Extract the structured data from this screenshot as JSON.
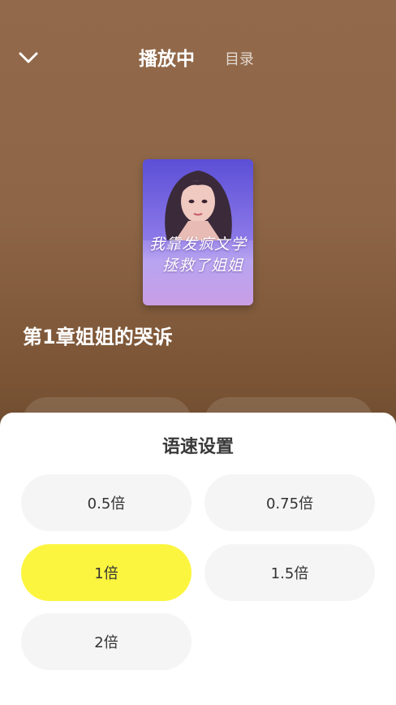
{
  "header": {
    "playing_tab": "播放中",
    "catalog_tab": "目录"
  },
  "cover": {
    "title_line1": "我靠发疯文学",
    "title_line2": "拯救了姐姐"
  },
  "chapter": {
    "title": "第1章姐姐的哭诉"
  },
  "speed_sheet": {
    "title": "语速设置",
    "selected": "1倍",
    "options": [
      {
        "label": "0.5倍"
      },
      {
        "label": "0.75倍"
      },
      {
        "label": "1倍"
      },
      {
        "label": "1.5倍"
      },
      {
        "label": "2倍"
      }
    ]
  },
  "colors": {
    "selected_option": "#fcf540",
    "option_bg": "#f5f5f5",
    "player_bg": "#8e6647"
  },
  "icons": {
    "back": "chevron-down-icon"
  }
}
